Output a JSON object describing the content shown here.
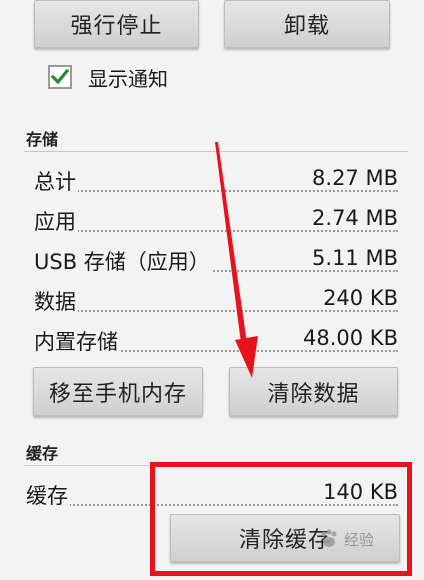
{
  "buttons": {
    "force_stop": "强行停止",
    "uninstall": "卸载",
    "move_to_phone": "移至手机内存",
    "clear_data": "清除数据",
    "clear_cache": "清除缓存"
  },
  "notification": {
    "label": "显示通知",
    "checked": true
  },
  "storage": {
    "header": "存储",
    "rows": [
      {
        "label": "总计",
        "value": "8.27 MB"
      },
      {
        "label": "应用",
        "value": "2.74 MB"
      },
      {
        "label": "USB 存储（应用）",
        "value": "5.11 MB"
      },
      {
        "label": "数据",
        "value": "240 KB"
      },
      {
        "label": "内置存储",
        "value": "48.00 KB"
      }
    ]
  },
  "cache": {
    "header": "缓存",
    "label": "缓存",
    "value": "140 KB"
  },
  "watermark": {
    "text": "经验"
  },
  "colors": {
    "highlight_red": "#e8121d",
    "check_green": "#2a8a2a"
  }
}
